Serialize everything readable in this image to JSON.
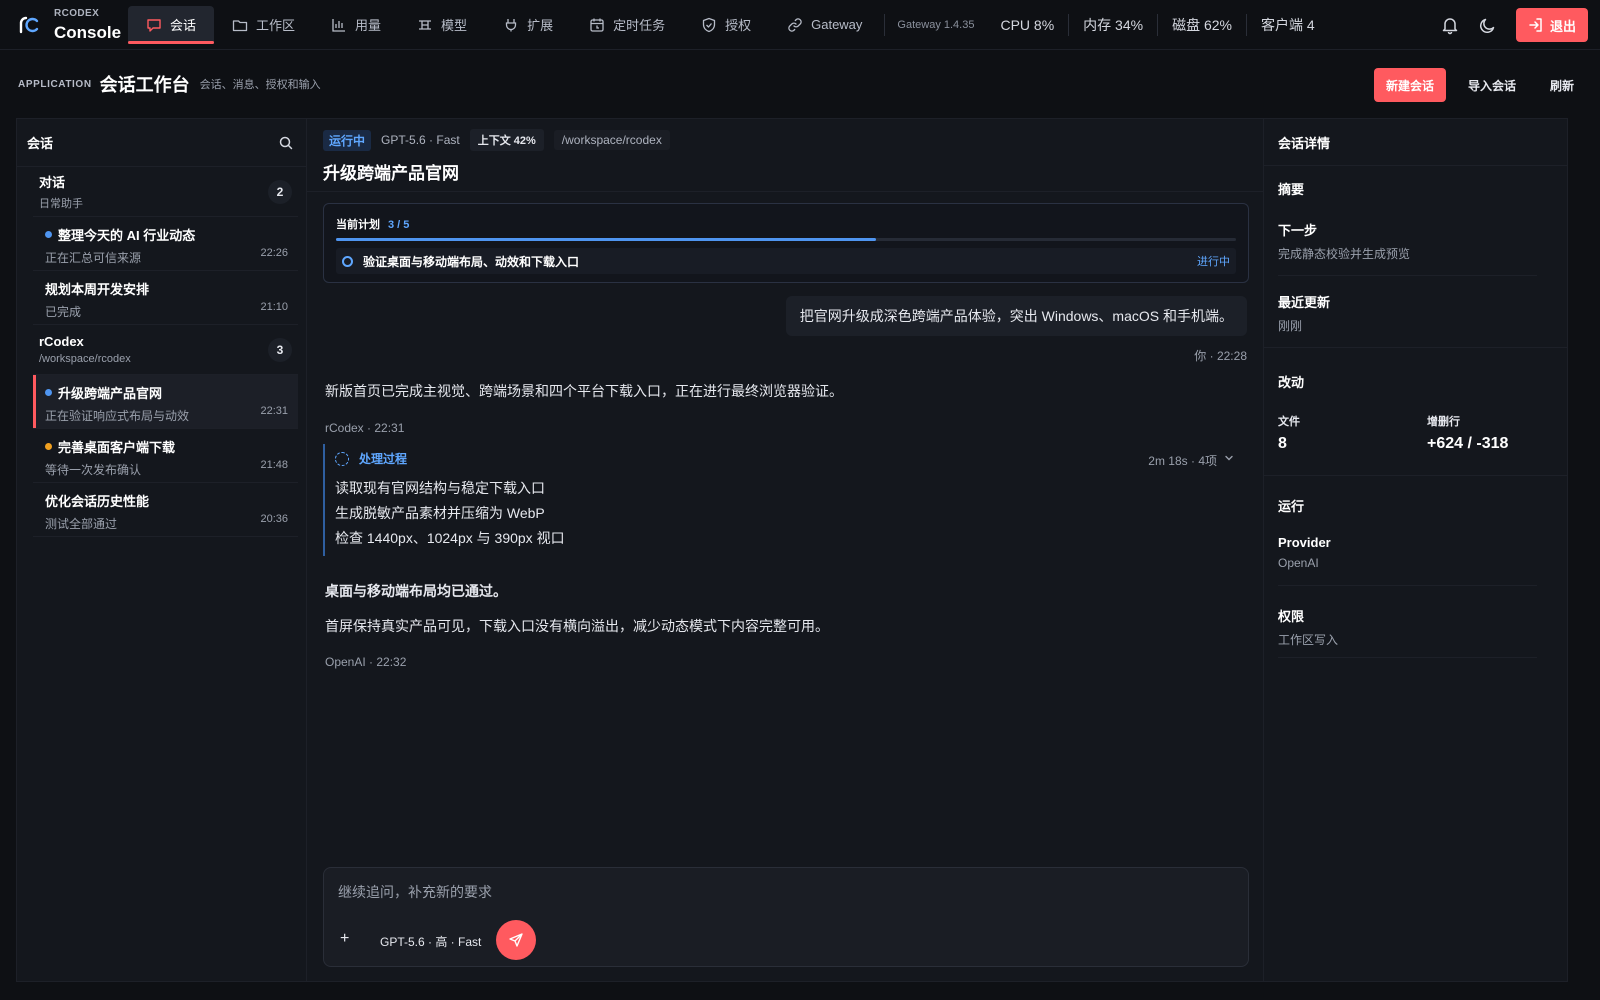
{
  "brand": {
    "small": "RCODEX",
    "name": "Console"
  },
  "nav": [
    {
      "label": "会话",
      "icon": "chat-icon",
      "active": true
    },
    {
      "label": "工作区",
      "icon": "folder-icon",
      "active": false
    },
    {
      "label": "用量",
      "icon": "bar-chart-icon",
      "active": false
    },
    {
      "label": "模型",
      "icon": "model-icon",
      "active": false
    },
    {
      "label": "扩展",
      "icon": "plug-icon",
      "active": false
    },
    {
      "label": "定时任务",
      "icon": "calendar-icon",
      "active": false
    },
    {
      "label": "授权",
      "icon": "shield-icon",
      "active": false
    },
    {
      "label": "Gateway",
      "icon": "link-icon",
      "active": false
    }
  ],
  "status": {
    "gateway_version": "Gateway 1.4.35",
    "cpu": "CPU 8%",
    "memory": "内存 34%",
    "disk": "磁盘 62%",
    "clients": "客户端 4"
  },
  "top_actions": {
    "logout_label": "退出"
  },
  "subheader": {
    "tag": "APPLICATION",
    "title": "会话工作台",
    "desc": "会话、消息、授权和输入",
    "new_label": "新建会话",
    "import_label": "导入会话",
    "refresh_label": "刷新"
  },
  "sessions": {
    "title": "会话",
    "groups": [
      {
        "name": "对话",
        "sub": "日常助手",
        "count": "2",
        "items": [
          {
            "title": "整理今天的 AI 行业动态",
            "sub": "正在汇总可信来源",
            "time": "22:26",
            "dot": "#4f95f0",
            "active": false
          },
          {
            "title": "规划本周开发安排",
            "sub": "已完成",
            "time": "21:10",
            "dot": "",
            "active": false
          }
        ]
      },
      {
        "name": "rCodex",
        "sub": "/workspace/rcodex",
        "count": "3",
        "items": [
          {
            "title": "升级跨端产品官网",
            "sub": "正在验证响应式布局与动效",
            "time": "22:31",
            "dot": "#4f95f0",
            "active": true
          },
          {
            "title": "完善桌面客户端下载",
            "sub": "等待一次发布确认",
            "time": "21:48",
            "dot": "#f0a020",
            "active": false
          },
          {
            "title": "优化会话历史性能",
            "sub": "测试全部通过",
            "time": "20:36",
            "dot": "",
            "active": false
          }
        ]
      }
    ]
  },
  "chat": {
    "status_badge": "运行中",
    "model": "GPT-5.6 · Fast",
    "context": "上下文 42%",
    "path": "/workspace/rcodex",
    "title": "升级跨端产品官网",
    "plan": {
      "label": "当前计划",
      "count": "3 / 5",
      "progress": 0.6,
      "step": "验证桌面与移动端布局、动效和下载入口",
      "step_status": "进行中"
    },
    "user_message": "把官网升级成深色跨端产品体验，突出 Windows、macOS 和手机端。",
    "user_meta": "你 · 22:28",
    "reply1": "新版首页已完成主视觉、跨端场景和四个平台下载入口，正在进行最终浏览器验证。",
    "reply1_meta": "rCodex · 22:31",
    "process": {
      "label": "处理过程",
      "stats": "2m 18s · 4项",
      "lines": [
        "读取现有官网结构与稳定下载入口",
        "生成脱敏产品素材并压缩为 WebP",
        "检查 1440px、1024px 与 390px 视口"
      ]
    },
    "reply2_bold": "桌面与移动端布局均已通过。",
    "reply2": "首屏保持真实产品可见，下载入口没有横向溢出，减少动态模式下内容完整可用。",
    "reply2_meta": "OpenAI · 22:32",
    "composer": {
      "placeholder": "继续追问，补充新的要求",
      "plus": "+",
      "model": "GPT-5.6 · 高 · Fast"
    }
  },
  "details": {
    "title": "会话详情",
    "summary_label": "摘要",
    "next_label": "下一步",
    "next_value": "完成静态校验并生成预览",
    "updated_label": "最近更新",
    "updated_value": "刚刚",
    "changes_label": "改动",
    "files_label": "文件",
    "files_value": "8",
    "lines_label": "增删行",
    "lines_value": "+624 / -318",
    "run_label": "运行",
    "provider_label": "Provider",
    "provider_value": "OpenAI",
    "perm_label": "权限",
    "perm_value": "工作区写入"
  },
  "colors": {
    "accent": "#ff5a5f",
    "blue": "#4f95f0",
    "orange": "#f0a020",
    "bg": "#0e1014"
  }
}
